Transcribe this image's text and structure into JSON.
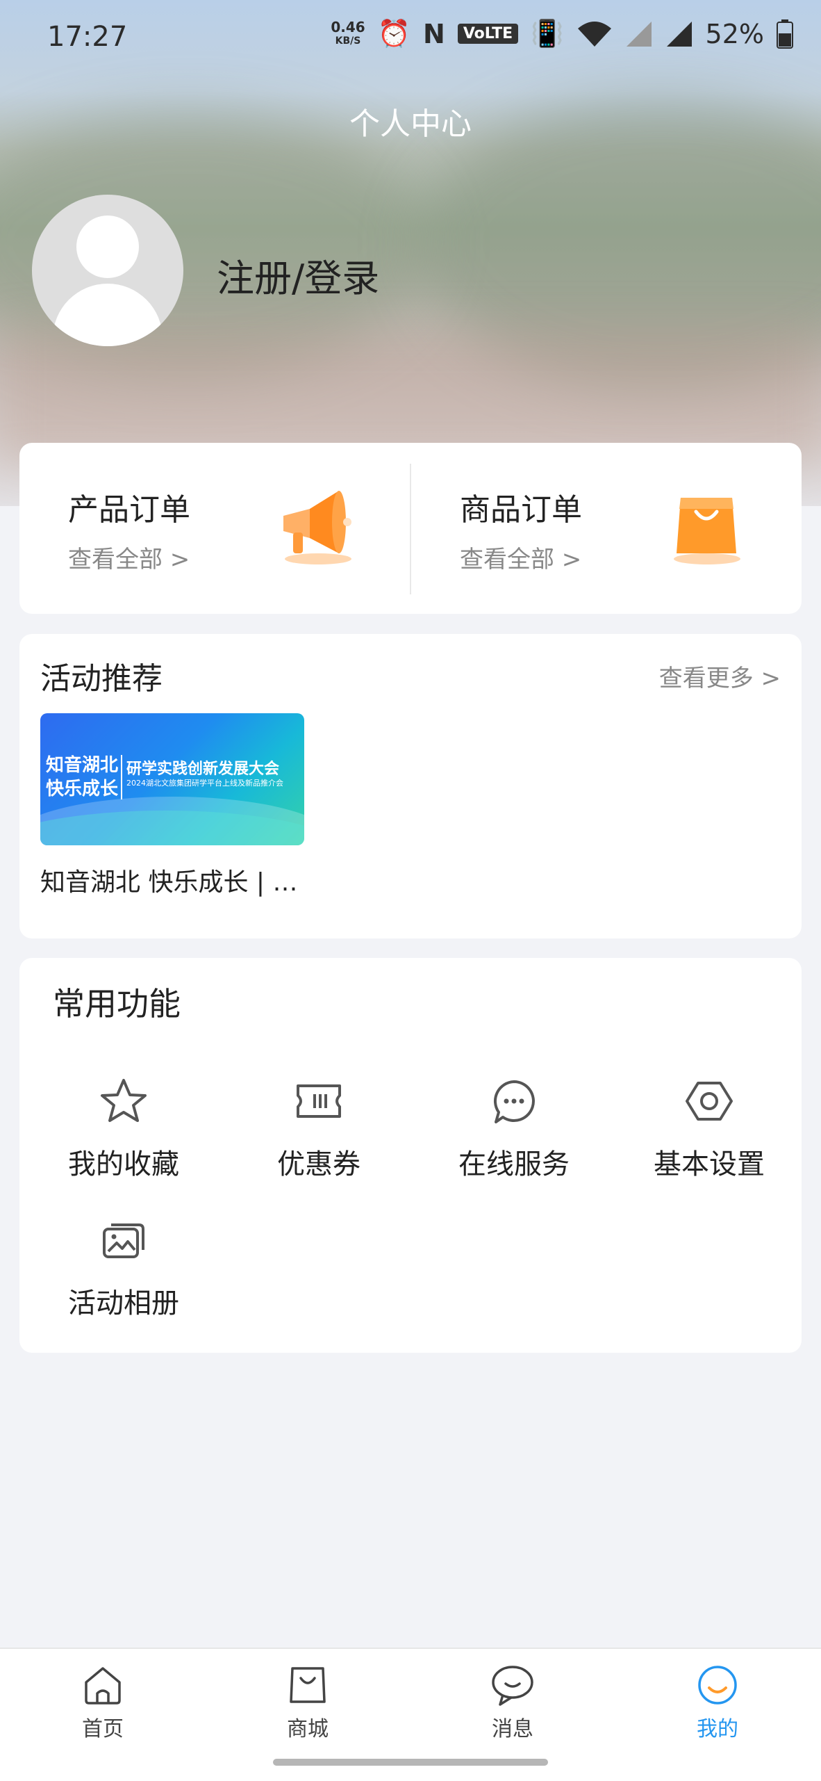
{
  "status_bar": {
    "time": "17:27",
    "net_speed_value": "0.46",
    "net_speed_unit": "KB/S",
    "volte": "VoLTE",
    "battery": "52%"
  },
  "header": {
    "title": "个人中心",
    "login_label": "注册/登录"
  },
  "orders": [
    {
      "title": "产品订单",
      "view_all": "查看全部 >",
      "icon": "megaphone-icon",
      "color": "#ff8a1f"
    },
    {
      "title": "商品订单",
      "view_all": "查看全部 >",
      "icon": "shopping-bag-icon",
      "color": "#ff9a2a"
    }
  ],
  "activity": {
    "title": "活动推荐",
    "more": "查看更多 >",
    "banner": {
      "line1a": "知音湖北",
      "line1b": "快乐成长",
      "headline": "研学实践创新发展大会",
      "subline": "2024湖北文旅集团研学平台上线及新品推介会"
    },
    "caption": "知音湖北 快乐成长 | …"
  },
  "functions": {
    "title": "常用功能",
    "items": [
      {
        "label": "我的收藏",
        "icon": "star-icon"
      },
      {
        "label": "优惠券",
        "icon": "coupon-icon"
      },
      {
        "label": "在线服务",
        "icon": "chat-dots-icon"
      },
      {
        "label": "基本设置",
        "icon": "settings-hexagon-icon"
      },
      {
        "label": "活动相册",
        "icon": "photo-album-icon"
      }
    ]
  },
  "tabbar": {
    "items": [
      {
        "label": "首页",
        "icon": "home-icon",
        "active": false
      },
      {
        "label": "商城",
        "icon": "bag-icon",
        "active": false
      },
      {
        "label": "消息",
        "icon": "message-icon",
        "active": false
      },
      {
        "label": "我的",
        "icon": "smile-icon",
        "active": true
      }
    ],
    "active_color": "#2496f0"
  }
}
